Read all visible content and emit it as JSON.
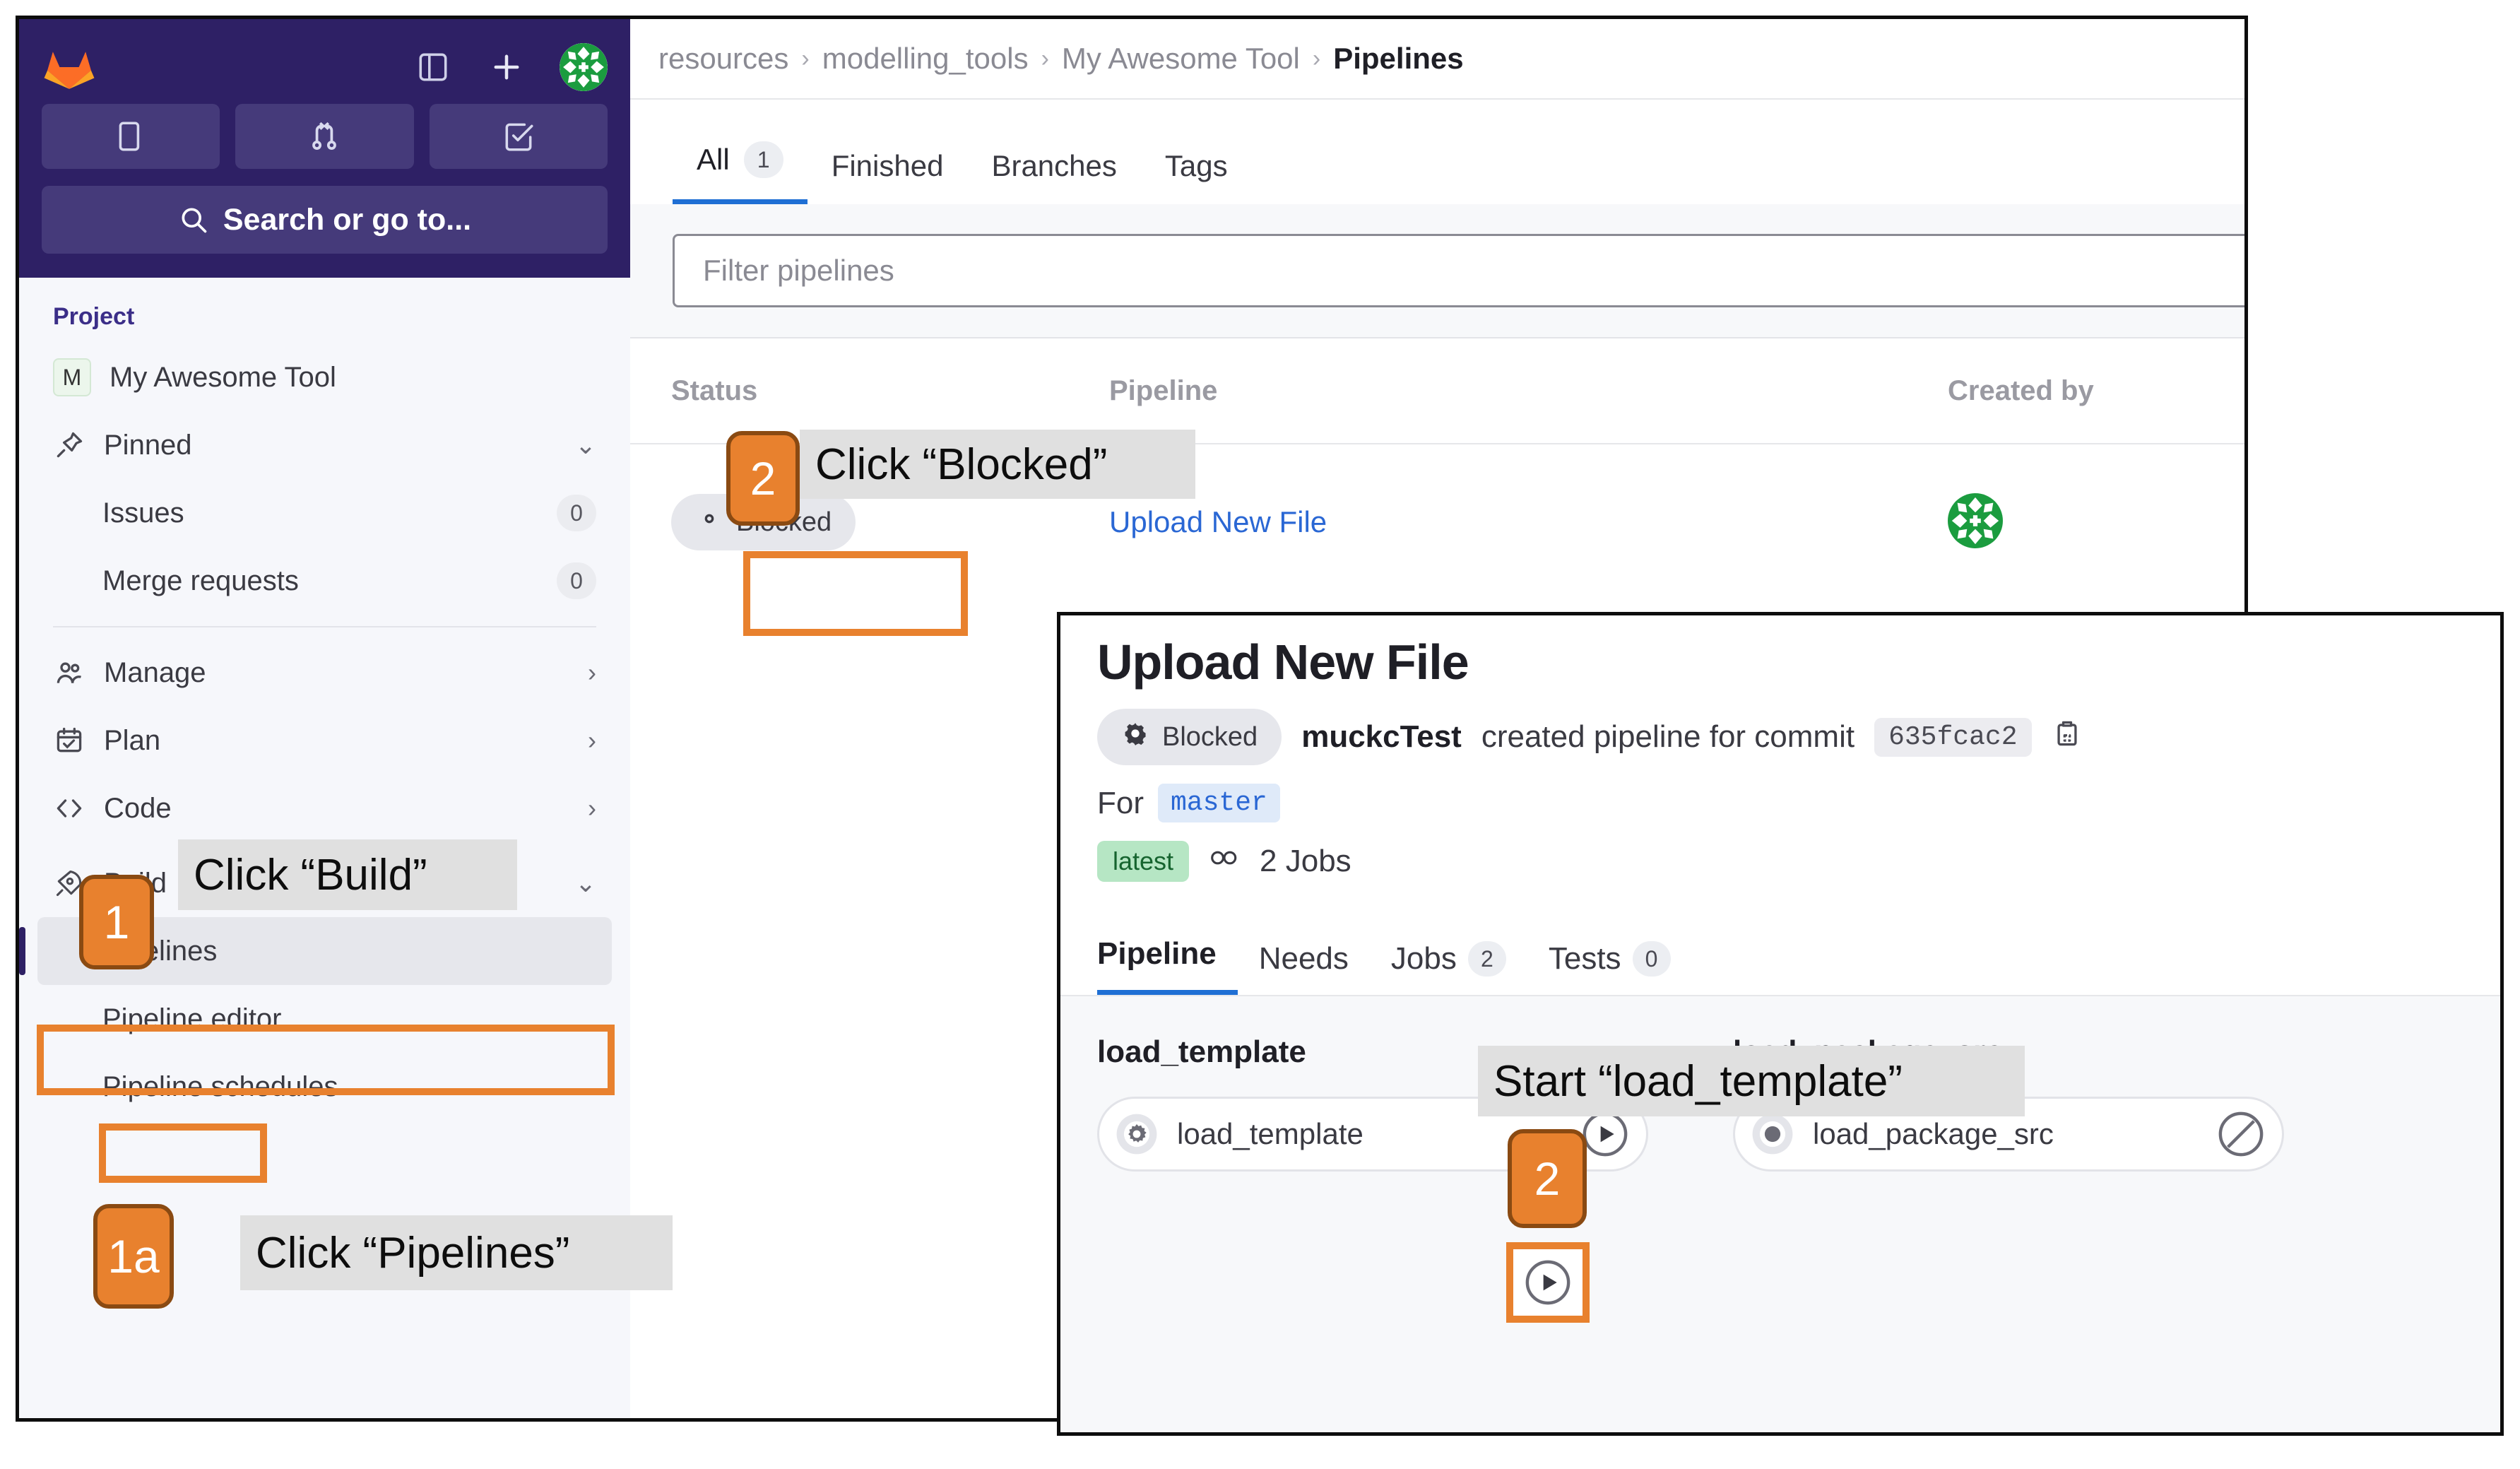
{
  "sidebar": {
    "search_placeholder": "Search or go to...",
    "section_label": "Project",
    "project": {
      "initial": "M",
      "name": "My Awesome Tool"
    },
    "items": [
      {
        "label": "Pinned",
        "icon": "pin-icon",
        "right": "chevron-down",
        "indent": false
      },
      {
        "label": "Issues",
        "icon": "",
        "right": "0",
        "indent": true
      },
      {
        "label": "Merge requests",
        "icon": "",
        "right": "0",
        "indent": true
      },
      {
        "label": "Manage",
        "icon": "users-icon",
        "right": "chevron-right",
        "indent": false
      },
      {
        "label": "Plan",
        "icon": "calendar-icon",
        "right": "chevron-right",
        "indent": false
      },
      {
        "label": "Code",
        "icon": "code-icon",
        "right": "chevron-right",
        "indent": false
      },
      {
        "label": "Build",
        "icon": "rocket-icon",
        "right": "chevron-down",
        "indent": false
      }
    ],
    "build_children": [
      {
        "label": "Pipelines",
        "active": true
      },
      {
        "label": "Pipeline editor",
        "active": false
      },
      {
        "label": "Pipeline schedules",
        "active": false
      }
    ],
    "top_icons": [
      {
        "name": "sidebar-toggle-icon"
      },
      {
        "name": "plus-icon"
      },
      {
        "name": "user-avatar"
      }
    ]
  },
  "breadcrumb": {
    "items": [
      "resources",
      "modelling_tools",
      "My Awesome Tool"
    ],
    "current": "Pipelines",
    "separator": "›"
  },
  "tabs": [
    {
      "label": "All",
      "count": "1",
      "active": true
    },
    {
      "label": "Finished",
      "count": "",
      "active": false
    },
    {
      "label": "Branches",
      "count": "",
      "active": false
    },
    {
      "label": "Tags",
      "count": "",
      "active": false
    }
  ],
  "filter": {
    "placeholder": "Filter pipelines"
  },
  "table": {
    "columns": {
      "status": "Status",
      "pipeline": "Pipeline",
      "created": "Created by"
    },
    "rows": [
      {
        "status": "Blocked",
        "status_icon": "gear-icon",
        "pipeline": "Upload New File",
        "avatar": "user-avatar"
      }
    ]
  },
  "popup": {
    "title": "Upload New File",
    "status": {
      "label": "Blocked",
      "icon": "gear-icon"
    },
    "author": "muckcTest",
    "action_text": "created pipeline for commit",
    "commit": "635fcac2",
    "copy_icon": "copy-icon",
    "for_label": "For",
    "branch": "master",
    "tag": "latest",
    "jobs_icon": "jobs-icon",
    "jobs_text": "2 Jobs",
    "tabs": [
      {
        "label": "Pipeline",
        "count": "",
        "active": true
      },
      {
        "label": "Needs",
        "count": "",
        "active": false
      },
      {
        "label": "Jobs",
        "count": "2",
        "active": false
      },
      {
        "label": "Tests",
        "count": "0",
        "active": false
      }
    ],
    "stages": [
      {
        "name": "load_template",
        "job": {
          "name": "load_template",
          "icon": "gear-pending-icon",
          "action": "play-icon"
        }
      },
      {
        "name": "load_package_src",
        "job": {
          "name": "load_package_src",
          "icon": "created-dot-icon",
          "action": "blocked-icon"
        }
      }
    ]
  },
  "annotations": [
    {
      "id": "a1",
      "badge": "1",
      "label": "Click “Build”"
    },
    {
      "id": "a1a",
      "badge": "1a",
      "label": "Click “Pipelines”"
    },
    {
      "id": "a2",
      "badge": "2",
      "label": "Click “Blocked”"
    },
    {
      "id": "a2b",
      "badge": "2",
      "label": "Start “load_template”"
    }
  ],
  "colors": {
    "accent_orange": "#e8812e",
    "accent_orange_border": "#8a4a12",
    "gitlab_navy": "#2e2065",
    "link_blue": "#2a67d4",
    "tab_underline": "#1f6fd4",
    "label_bg": "#e0e0e0"
  }
}
